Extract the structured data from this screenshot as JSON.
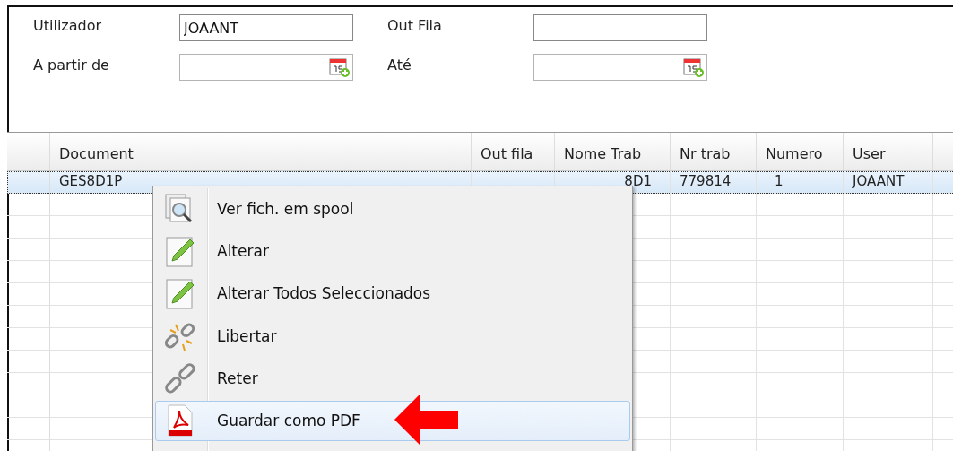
{
  "form": {
    "fields": [
      {
        "label": "Utilizador",
        "value": "JOAANT",
        "kind": "text"
      },
      {
        "label": "Out Fila",
        "kind": "text"
      },
      {
        "label": "A partir de",
        "kind": "date"
      },
      {
        "label": "Até",
        "kind": "date"
      }
    ]
  },
  "table": {
    "columns": [
      "Document",
      "Out fila",
      "Nome Trab",
      "Nr trab",
      "Numero",
      "User"
    ],
    "rows": [
      {
        "selected": true,
        "cells": [
          "GES8D1P",
          "",
          "8D1",
          "779814",
          "1",
          "JOAANT"
        ]
      }
    ]
  },
  "context_menu": {
    "items": [
      {
        "label": "Ver fich. em spool",
        "kind": "preview",
        "selected": false
      },
      {
        "label": "Alterar",
        "kind": "edit",
        "selected": false
      },
      {
        "label": "Alterar Todos Seleccionados",
        "kind": "edit",
        "selected": false
      },
      {
        "label": "Libertar",
        "kind": "unlink",
        "selected": false
      },
      {
        "label": "Reter",
        "kind": "link",
        "selected": false
      },
      {
        "label": "Guardar como PDF",
        "kind": "pdf",
        "selected": true
      }
    ]
  }
}
